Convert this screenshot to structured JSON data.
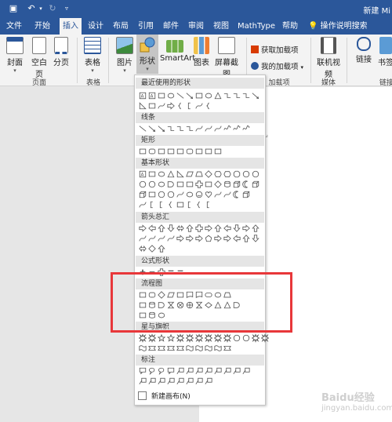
{
  "title_bar": {
    "doc_title": "新建 Mi"
  },
  "tabs": [
    {
      "label": "文件"
    },
    {
      "label": "开始"
    },
    {
      "label": "插入"
    },
    {
      "label": "设计"
    },
    {
      "label": "布局"
    },
    {
      "label": "引用"
    },
    {
      "label": "邮件"
    },
    {
      "label": "审阅"
    },
    {
      "label": "视图"
    },
    {
      "label": "MathType"
    },
    {
      "label": "帮助"
    }
  ],
  "tell_me": "操作说明搜索",
  "ribbon": {
    "cover": "封面",
    "blank": "空白页",
    "break": "分页",
    "table": "表格",
    "picture": "图片",
    "shapes": "形状",
    "smartart": "SmartArt",
    "chart": "图表",
    "screenshot": "屏幕截图",
    "get_addins": "获取加载项",
    "my_addins": "我的加载项",
    "online_video": "联机视频",
    "link": "链接",
    "bookmark": "书签",
    "groups": {
      "pages": "页面",
      "tables": "表格",
      "addins": "加载项",
      "media": "媒体",
      "links": "链接"
    }
  },
  "shapes_menu": {
    "sections": [
      {
        "title": "最近使用的形状"
      },
      {
        "title": "线条"
      },
      {
        "title": "矩形"
      },
      {
        "title": "基本形状"
      },
      {
        "title": "箭头总汇"
      },
      {
        "title": "公式形状"
      },
      {
        "title": "流程图"
      },
      {
        "title": "星与旗帜"
      },
      {
        "title": "标注"
      }
    ],
    "new_canvas": "新建画布(N)"
  },
  "watermark": {
    "line1": "Baidu经验",
    "line2": "jingyan.baidu.com"
  },
  "colors": {
    "accent": "#2b579a",
    "highlight": "#e8373a"
  }
}
